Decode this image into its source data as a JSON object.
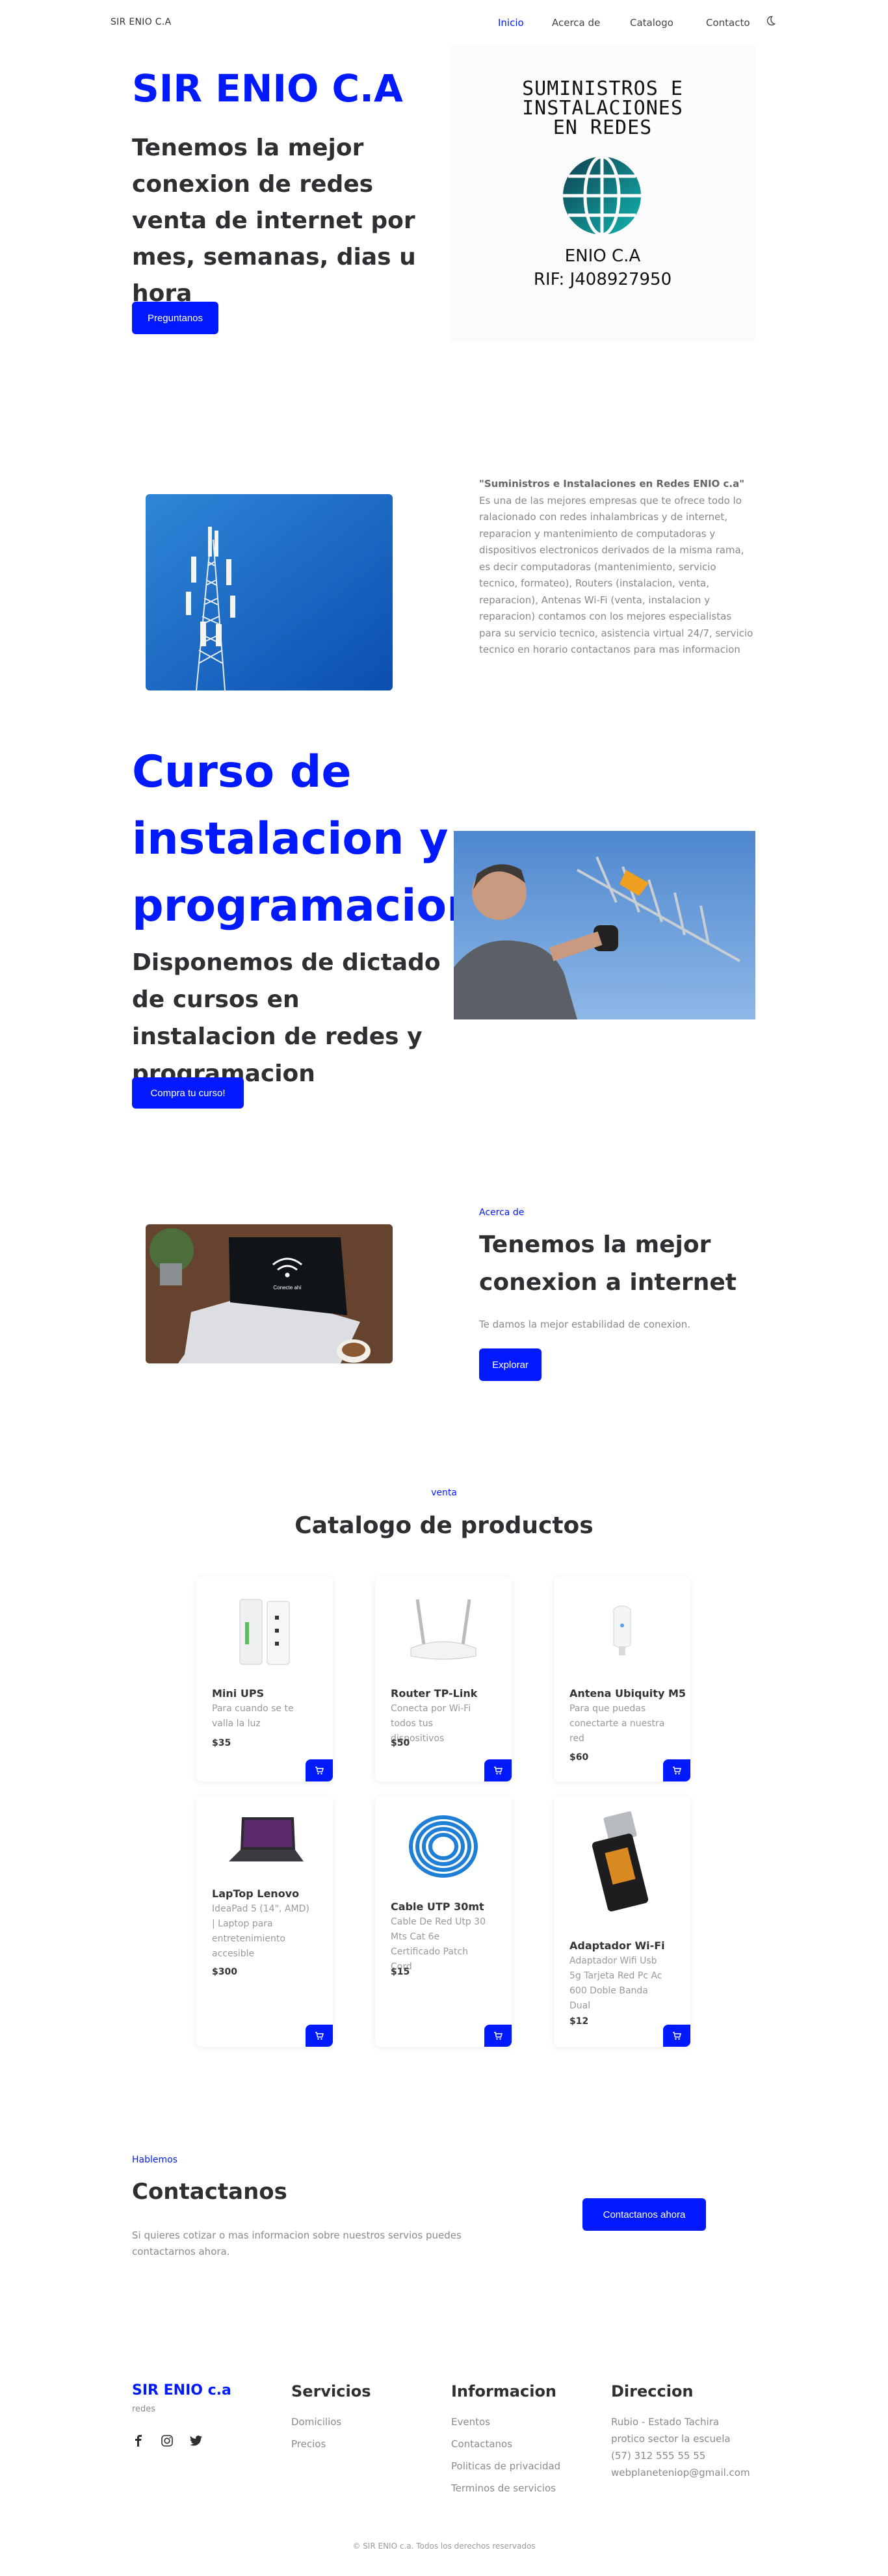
{
  "header": {
    "brand": "SIR ENIO C.A",
    "nav": [
      "Inicio",
      "Acerca de",
      "Catalogo",
      "Contacto"
    ]
  },
  "hero": {
    "title": "SIR ENIO C.A",
    "subtitle": "Tenemos la mejor conexion de redes venta de internet por mes, semanas, dias u hora",
    "button": "Preguntanos",
    "logo_line1": "SUMINISTROS E",
    "logo_line2": "INSTALACIONES",
    "logo_line3": "EN REDES",
    "logo_name": "ENIO C.A",
    "logo_rif": "RIF: J408927950"
  },
  "about": {
    "lead": "\"Suministros e Instalaciones en Redes ENIO c.a\"",
    "text": " Es una de las mejores empresas que te ofrece todo lo ralacionado con redes inhalambricas y de internet, reparacion y mantenimiento de computadoras y dispositivos electronicos derivados de la misma rama, es decir computadoras (mantenimiento, servicio tecnico, formateo), Routers (instalacion, venta, reparacion), Antenas Wi-Fi (venta, instalacion y reparacion) contamos con los mejores especialistas para su servicio tecnico, asistencia virtual 24/7, servicio tecnico en horario contactanos para mas informacion"
  },
  "course": {
    "title": "Curso de instalacion y programacion",
    "subtitle": "Disponemos de dictado de cursos en instalacion de redes y programacion",
    "button": "Compra tu curso!"
  },
  "acerca": {
    "eyebrow": "Acerca de",
    "title": "Tenemos la mejor conexion a internet",
    "text": "Te damos la mejor estabilidad de conexion.",
    "button": "Explorar",
    "laptop_screen": "Conecte ahí"
  },
  "catalog": {
    "eyebrow": "venta",
    "title": "Catalogo de productos",
    "products": [
      {
        "name": "Mini UPS",
        "desc": "Para cuando se te valla la luz",
        "price": "$35"
      },
      {
        "name": "Router TP-Link",
        "desc": "Conecta por Wi-Fi todos tus dispositivos",
        "price": "$50"
      },
      {
        "name": "Antena Ubiquity M5",
        "desc": "Para que puedas conectarte a nuestra red",
        "price": "$60"
      },
      {
        "name": "LapTop Lenovo",
        "desc": "IdeaPad 5 (14\", AMD) | Laptop para entretenimiento accesible",
        "price": "$300"
      },
      {
        "name": "Cable UTP 30mt",
        "desc": "Cable De Red Utp 30 Mts Cat 6e Certificado Patch Cord",
        "price": "$15"
      },
      {
        "name": "Adaptador Wi-Fi",
        "desc": "Adaptador Wifi Usb 5g Tarjeta Red Pc Ac 600 Doble Banda Dual",
        "price": "$12"
      }
    ]
  },
  "contact": {
    "eyebrow": "Hablemos",
    "title": "Contactanos",
    "text": "Si quieres cotizar o mas informacion sobre nuestros servios puedes contactarnos ahora.",
    "button": "Contactanos ahora"
  },
  "footer": {
    "brand": "SIR ENIO c.a",
    "tagline": "redes",
    "servicios_title": "Servicios",
    "servicios": [
      "Domicilios",
      "Precios"
    ],
    "info_title": "Informacion",
    "info": [
      "Eventos",
      "Contactanos",
      "Politicas de privacidad",
      "Terminos de servicios"
    ],
    "dir_title": "Direccion",
    "dir": [
      "Rubio - Estado Tachira",
      "protico sector la escuela",
      "(57) 312 555 55 55",
      "webplaneteniop@gmail.com"
    ],
    "copyright": "© SIR ENIO c.a. Todos los derechos reservados"
  },
  "colors": {
    "accent": "#0019ff",
    "text": "#2f2f33",
    "muted": "#8a8a8a"
  },
  "icons": [
    "moon-icon",
    "cart-icon",
    "facebook-icon",
    "instagram-icon",
    "twitter-icon",
    "wifi-icon",
    "globe-icon"
  ]
}
